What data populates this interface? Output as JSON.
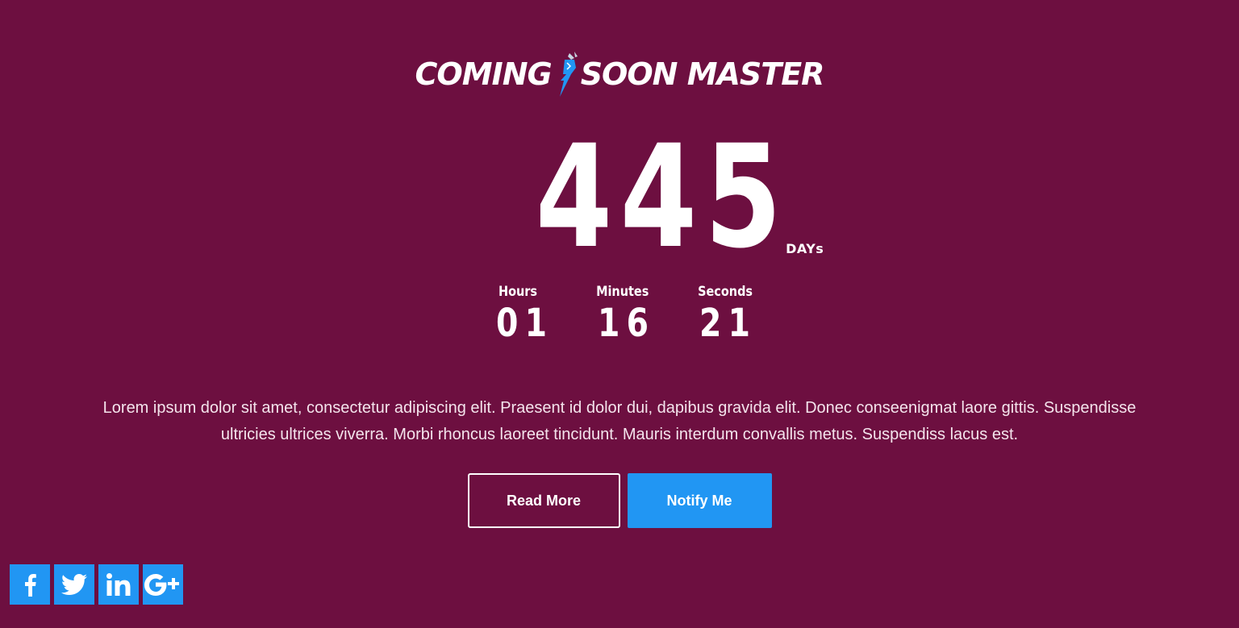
{
  "logo": {
    "text_left": "Coming",
    "text_right": "Soon Master",
    "accent_color": "#2196f3"
  },
  "countdown": {
    "days": {
      "value": "445",
      "label": "DAYs"
    },
    "hours": {
      "value": "01",
      "label": "Hours"
    },
    "minutes": {
      "value": "16",
      "label": "Minutes"
    },
    "seconds": {
      "value": "21",
      "label": "Seconds"
    }
  },
  "description": "Lorem ipsum dolor sit amet, consectetur adipiscing elit. Praesent id dolor dui, dapibus gravida elit. Donec conseenigmat laore gittis. Suspendisse ultricies ultrices viverra. Morbi rhoncus laoreet tincidunt. Mauris interdum convallis metus. Suspendiss lacus est.",
  "buttons": {
    "read_more": "Read More",
    "notify_me": "Notify Me"
  },
  "social": [
    {
      "name": "facebook",
      "icon": "facebook-icon"
    },
    {
      "name": "twitter",
      "icon": "twitter-icon"
    },
    {
      "name": "linkedin",
      "icon": "linkedin-icon"
    },
    {
      "name": "google-plus",
      "icon": "google-plus-icon"
    }
  ],
  "colors": {
    "background": "#6d0f40",
    "accent": "#2196f3",
    "text": "#ffffff"
  }
}
